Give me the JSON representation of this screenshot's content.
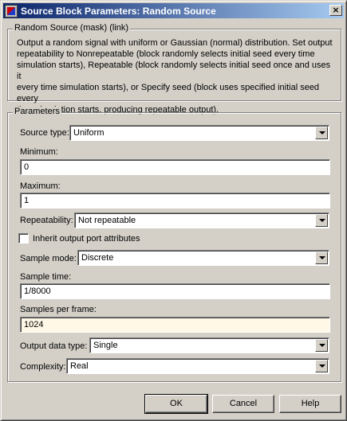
{
  "window": {
    "title": "Source Block Parameters: Random Source",
    "close_glyph": "×"
  },
  "description_group": {
    "legend": "Random Source (mask) (link)",
    "text": "Output a random signal with uniform or Gaussian (normal) distribution.  Set output\nrepeatability to Nonrepeatable (block randomly selects initial seed every time\nsimulation starts), Repeatable (block randomly selects initial seed once and uses it\nevery time simulation starts), or Specify seed (block uses specified initial seed every\ntime simulation starts, producing repeatable output)."
  },
  "parameters": {
    "legend": "Parameters",
    "source_type": {
      "label": "Source type:",
      "value": "Uniform"
    },
    "minimum": {
      "label": "Minimum:",
      "value": "0"
    },
    "maximum": {
      "label": "Maximum:",
      "value": "1"
    },
    "repeatability": {
      "label": "Repeatability:",
      "value": "Not repeatable"
    },
    "inherit": {
      "label": "Inherit output port attributes",
      "checked": false
    },
    "sample_mode": {
      "label": "Sample mode:",
      "value": "Discrete"
    },
    "sample_time": {
      "label": "Sample time:",
      "value": "1/8000"
    },
    "samples_per_frame": {
      "label": "Samples per frame:",
      "value": "1024"
    },
    "output_data_type": {
      "label": "Output data type:",
      "value": "Single"
    },
    "complexity": {
      "label": "Complexity:",
      "value": "Real"
    }
  },
  "buttons": {
    "ok": "OK",
    "cancel": "Cancel",
    "help": "Help"
  }
}
